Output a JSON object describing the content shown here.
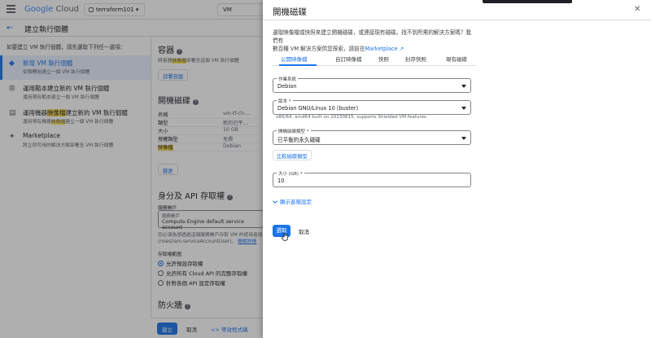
{
  "topbar": {
    "logo_google": "Google",
    "logo_cloud": " Cloud",
    "project": "terraform101",
    "search": "VM"
  },
  "subbar": {
    "title": "建立執行個體"
  },
  "left": {
    "intro": "如要建立 VM 執行個體，請先選取下列任一選項：",
    "options": [
      {
        "title": "新增 VM 執行個體",
        "desc": "從頭開始建立一個 VM 執行個體"
      },
      {
        "title": "運用範本建立新的 VM 執行個體",
        "desc": "運用現有範本建立一個 VM 執行個體"
      },
      {
        "title_pre": "運用機器",
        "title_hl": "映像檔",
        "title_post": "建立新的 VM 執行個體",
        "desc_pre": "運用現有機器",
        "desc_hl": "映像檔",
        "desc_post": "建立一個 VM 執行個體"
      },
      {
        "title": "Marketplace",
        "desc": "將立即可用的解決方案部署至 VM 執行個體"
      }
    ]
  },
  "main": {
    "container_title": "容器",
    "container_desc_pre": "將容器",
    "container_desc_hl": "映像檔",
    "container_desc_post": "部署至這個 VM 執行個體",
    "deploy_container": "部署容器",
    "boot_disk_title": "開機磁碟",
    "boot_rows": [
      {
        "k": "名稱",
        "v": "vm-tf-ch-..."
      },
      {
        "k": "類型",
        "v": "新的已平..."
      },
      {
        "k": "大小",
        "v": "10 GB"
      },
      {
        "k": "授權類型",
        "v": "免費"
      },
      {
        "k": "映像檔",
        "v": "Debian"
      }
    ],
    "change": "變更",
    "identity_title": "身分及 API 存取權",
    "service_account_label": "服務帳戶",
    "service_account_field_label": "服務帳戶",
    "service_account_value": "Compute Engine default service account",
    "service_account_hint": "您必須為想透過這個服務帳戶存取 VM 的使用者授...",
    "service_account_hint2": "(roles/iam.serviceAccountUser)。",
    "learn_more": "瞭解詳情",
    "scope_label": "存取權範圍",
    "scopes": [
      "允許預設存取權",
      "允許所有 Cloud API 的完整存取權",
      "針對各個 API 設定存取權"
    ],
    "firewall_title": "防火牆",
    "create": "建立",
    "cancel": "取消",
    "equivalent_code": "等效程式碼"
  },
  "panel": {
    "title": "開機磁碟",
    "desc_line1": "選取映像檔或快照來建立開機磁碟，或連接現有磁碟。找不到所需的解決方案嗎？我們有",
    "desc_line2": "數百種 VM 解決方案供您探索，請前往",
    "desc_link": "Marketplace",
    "tabs": [
      "公開映像檔",
      "自訂映像檔",
      "快照",
      "封存快照",
      "現有磁碟"
    ],
    "os_label": "作業系統",
    "os_value": "Debian",
    "version_label": "版本 *",
    "version_value": "Debian GNU/Linux 10 (buster)",
    "version_hint": "x86/64, amd64 built on 20230615, supports Shielded VM features",
    "disk_type_label": "開機磁碟類型 *",
    "disk_type_value": "已平衡的永久磁碟",
    "compare": "比較磁碟類型",
    "size_label": "大小 (GB) *",
    "size_value": "10",
    "advanced": "顯示進階設定",
    "select": "選取",
    "cancel": "取消"
  }
}
